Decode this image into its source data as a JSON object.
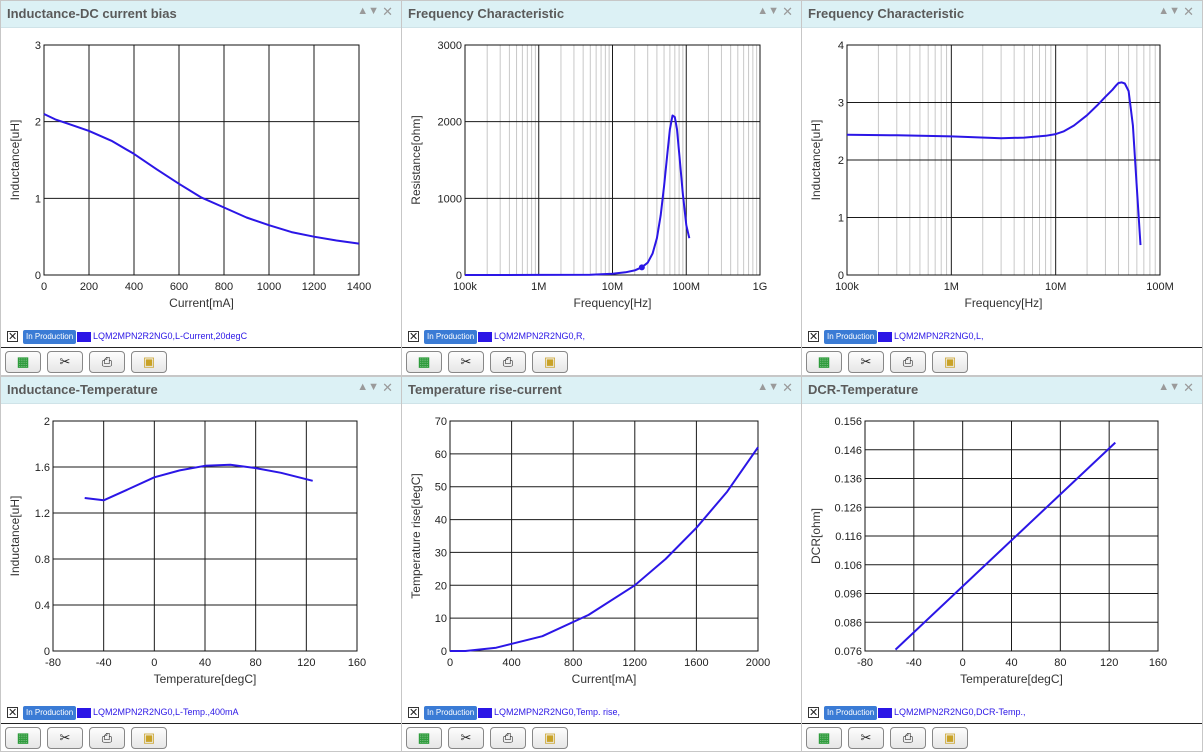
{
  "panels": [
    {
      "title": "Inductance-DC current bias",
      "legend": {
        "status": "In Production",
        "text": "LQM2MPN2R2NG0,L-Current,20degC"
      },
      "chart_data": {
        "type": "line",
        "xlabel": "Current[mA]",
        "ylabel": "Inductance[uH]",
        "xscale": "linear",
        "yscale": "linear",
        "xlim": [
          0,
          1400
        ],
        "ylim": [
          0,
          3
        ],
        "xticks": [
          0,
          200,
          400,
          600,
          800,
          1000,
          1200,
          1400
        ],
        "xticklabels": [
          "0",
          "200",
          "400",
          "600",
          "800",
          "1000",
          "1200",
          "1400"
        ],
        "yticks": [
          0,
          1,
          2,
          3
        ],
        "yticklabels": [
          "0",
          "1",
          "2",
          "3"
        ],
        "grid": true,
        "series": [
          {
            "x": [
              0,
              50,
              100,
              200,
              300,
              400,
              500,
              600,
              700,
              800,
              900,
              1000,
              1100,
              1200,
              1300,
              1400
            ],
            "y": [
              2.1,
              2.03,
              1.98,
              1.88,
              1.75,
              1.58,
              1.38,
              1.19,
              1.01,
              0.88,
              0.75,
              0.65,
              0.56,
              0.5,
              0.45,
              0.41
            ]
          }
        ]
      }
    },
    {
      "title": "Frequency Characteristic",
      "legend": {
        "status": "In Production",
        "text": "LQM2MPN2R2NG0,R,"
      },
      "chart_data": {
        "type": "line",
        "xlabel": "Frequency[Hz]",
        "ylabel": "Resistance[ohm]",
        "xscale": "log",
        "yscale": "linear",
        "xlim": [
          100000,
          1000000000
        ],
        "ylim": [
          0,
          3000
        ],
        "xticks": [
          100000,
          1000000,
          10000000,
          100000000,
          1000000000
        ],
        "xticklabels": [
          "100k",
          "1M",
          "10M",
          "100M",
          "1G"
        ],
        "yticks": [
          0,
          1000,
          2000,
          3000
        ],
        "yticklabels": [
          "0",
          "1000",
          "2000",
          "3000"
        ],
        "grid": true,
        "series": [
          {
            "x": [
              100000,
              1000000,
              5000000,
              10000000,
              15000000,
              20000000,
              25000000,
              30000000,
              35000000,
              40000000,
              45000000,
              50000000,
              55000000,
              60000000,
              65000000,
              70000000,
              75000000,
              80000000,
              90000000,
              100000000,
              110000000
            ],
            "y": [
              0,
              1,
              4,
              15,
              35,
              60,
              100,
              160,
              280,
              480,
              780,
              1150,
              1550,
              1900,
              2080,
              2060,
              1900,
              1600,
              1050,
              650,
              480
            ],
            "marker": {
              "x": 25000000,
              "y": 100
            }
          }
        ]
      }
    },
    {
      "title": "Frequency Characteristic",
      "legend": {
        "status": "In Production",
        "text": "LQM2MPN2R2NG0,L,"
      },
      "chart_data": {
        "type": "line",
        "xlabel": "Frequency[Hz]",
        "ylabel": "Inductance[uH]",
        "xscale": "log",
        "yscale": "linear",
        "xlim": [
          100000,
          100000000
        ],
        "ylim": [
          0,
          4
        ],
        "xticks": [
          100000,
          1000000,
          10000000,
          100000000
        ],
        "xticklabels": [
          "100k",
          "1M",
          "10M",
          "100M"
        ],
        "yticks": [
          0,
          1,
          2,
          3,
          4
        ],
        "yticklabels": [
          "0",
          "1",
          "2",
          "3",
          "4"
        ],
        "grid": true,
        "series": [
          {
            "x": [
              100000,
              300000,
              1000000,
              3000000,
              5000000,
              8000000,
              10000000,
              12000000,
              15000000,
              20000000,
              25000000,
              30000000,
              35000000,
              38000000,
              40000000,
              43000000,
              46000000,
              50000000,
              55000000,
              60000000,
              65000000
            ],
            "y": [
              2.44,
              2.43,
              2.41,
              2.38,
              2.39,
              2.42,
              2.45,
              2.5,
              2.6,
              2.78,
              2.95,
              3.1,
              3.22,
              3.3,
              3.34,
              3.35,
              3.33,
              3.2,
              2.6,
              1.5,
              0.52
            ]
          }
        ]
      }
    },
    {
      "title": "Inductance-Temperature",
      "legend": {
        "status": "In Production",
        "text": "LQM2MPN2R2NG0,L-Temp.,400mA"
      },
      "chart_data": {
        "type": "line",
        "xlabel": "Temperature[degC]",
        "ylabel": "Inductance[uH]",
        "xscale": "linear",
        "yscale": "linear",
        "xlim": [
          -80,
          160
        ],
        "ylim": [
          0,
          2
        ],
        "xticks": [
          -80,
          -40,
          0,
          40,
          80,
          120,
          160
        ],
        "xticklabels": [
          "-80",
          "-40",
          "0",
          "40",
          "80",
          "120",
          "160"
        ],
        "yticks": [
          0,
          0.4,
          0.8,
          1.2,
          1.6,
          2
        ],
        "yticklabels": [
          "0",
          "0.4",
          "0.8",
          "1.2",
          "1.6",
          "2"
        ],
        "grid": true,
        "series": [
          {
            "x": [
              -55,
              -40,
              -20,
              0,
              20,
              40,
              60,
              80,
              100,
              125
            ],
            "y": [
              1.33,
              1.31,
              1.41,
              1.51,
              1.57,
              1.61,
              1.62,
              1.59,
              1.55,
              1.48
            ]
          }
        ]
      }
    },
    {
      "title": "Temperature rise-current",
      "legend": {
        "status": "In Production",
        "text": "LQM2MPN2R2NG0,Temp. rise,"
      },
      "chart_data": {
        "type": "line",
        "xlabel": "Current[mA]",
        "ylabel": "Temperature rise[degC]",
        "xscale": "linear",
        "yscale": "linear",
        "xlim": [
          0,
          2000
        ],
        "ylim": [
          0,
          70
        ],
        "xticks": [
          0,
          400,
          800,
          1200,
          1600,
          2000
        ],
        "xticklabels": [
          "0",
          "400",
          "800",
          "1200",
          "1600",
          "2000"
        ],
        "yticks": [
          0,
          10,
          20,
          30,
          40,
          50,
          60,
          70
        ],
        "yticklabels": [
          "0",
          "10",
          "20",
          "30",
          "40",
          "50",
          "60",
          "70"
        ],
        "grid": true,
        "series": [
          {
            "x": [
              0,
              100,
              300,
              600,
              900,
              1200,
              1400,
              1600,
              1800,
              2000
            ],
            "y": [
              0,
              0,
              1,
              4.5,
              11,
              20,
              28,
              37.5,
              48.5,
              62
            ]
          }
        ]
      }
    },
    {
      "title": "DCR-Temperature",
      "legend": {
        "status": "In Production",
        "text": "LQM2MPN2R2NG0,DCR-Temp.,"
      },
      "chart_data": {
        "type": "line",
        "xlabel": "Temperature[degC]",
        "ylabel": "DCR[ohm]",
        "xscale": "linear",
        "yscale": "linear",
        "xlim": [
          -80,
          160
        ],
        "ylim": [
          0.076,
          0.156
        ],
        "xticks": [
          -80,
          -40,
          0,
          40,
          80,
          120,
          160
        ],
        "xticklabels": [
          "-80",
          "-40",
          "0",
          "40",
          "80",
          "120",
          "160"
        ],
        "yticks": [
          0.076,
          0.086,
          0.096,
          0.106,
          0.116,
          0.126,
          0.136,
          0.146,
          0.156
        ],
        "yticklabels": [
          "0.076",
          "0.086",
          "0.096",
          "0.106",
          "0.116",
          "0.126",
          "0.136",
          "0.146",
          "0.156"
        ],
        "grid": true,
        "series": [
          {
            "x": [
              -55,
              125
            ],
            "y": [
              0.0765,
              0.1485
            ]
          }
        ]
      }
    }
  ],
  "ui": {
    "line_color": "#2b16e6",
    "grid_major_color": "#1a1a1a",
    "grid_minor_color": "#c8c8c8",
    "header_bg": "#dcf1f5",
    "collapse_icon": "▲▼",
    "close_icon": "✕",
    "checkbox_mark": "✕",
    "toolbar_icons": [
      "export-icon",
      "tools-icon",
      "print-icon",
      "image-icon"
    ]
  }
}
